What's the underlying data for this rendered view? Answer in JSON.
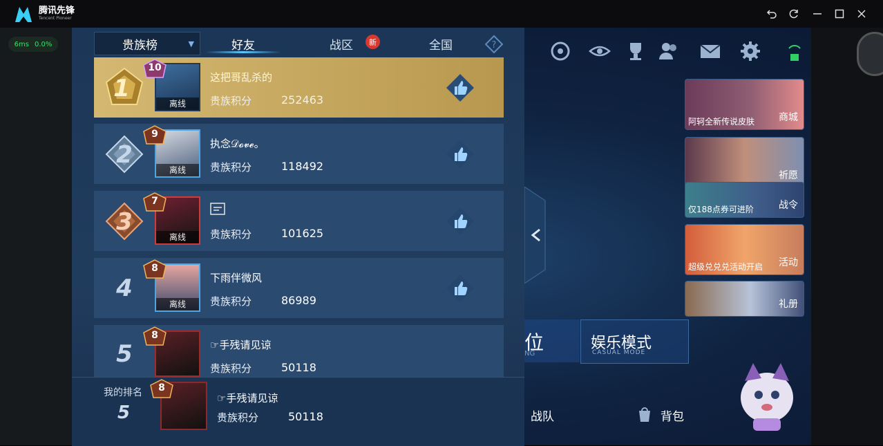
{
  "app": {
    "name": "腾讯先锋",
    "subtitle": "Tencent Pioneer"
  },
  "window_controls": [
    "back-icon",
    "refresh-icon",
    "minimize-icon",
    "maximize-icon",
    "close-icon"
  ],
  "ping": {
    "latency": "6ms",
    "loss": "0.0%"
  },
  "tabs": {
    "dropdown": "贵族榜",
    "items": [
      {
        "label": "好友",
        "active": true
      },
      {
        "label": "战区",
        "badge": "新"
      },
      {
        "label": "全国"
      }
    ]
  },
  "rows": [
    {
      "rank": "1",
      "level": "10",
      "name": "这把哥乱杀的",
      "score_label": "贵族积分",
      "score": "252463",
      "status": "离线"
    },
    {
      "rank": "2",
      "level": "9",
      "name": "执念𝒟𝓸𝓿𝓮。",
      "score_label": "贵族积分",
      "score": "118492",
      "status": "离线"
    },
    {
      "rank": "3",
      "level": "7",
      "name": "",
      "score_label": "贵族积分",
      "score": "101625",
      "status": "离线"
    },
    {
      "rank": "4",
      "level": "8",
      "name": "下雨伴微风",
      "score_label": "贵族积分",
      "score": "86989",
      "status": "离线"
    },
    {
      "rank": "5",
      "level": "8",
      "name": "☞手残请见谅",
      "score_label": "贵族积分",
      "score": "50118",
      "status": ""
    }
  ],
  "my_rank": {
    "label": "我的排名",
    "rank": "5",
    "level": "8",
    "name": "☞手残请见谅",
    "score_label": "贵族积分",
    "score": "50118"
  },
  "side_cards": [
    {
      "caption": "阿轲全新传说皮肤",
      "label": "商城"
    },
    {
      "caption": "",
      "label": "祈愿"
    },
    {
      "caption": "仅188点券可进阶",
      "label": "战令"
    },
    {
      "caption": "超级兑兑兑活动开启",
      "label": "活动"
    },
    {
      "caption": "",
      "label": "礼册"
    }
  ],
  "modes": {
    "left_title": "位",
    "left_sub": "NG",
    "title": "娱乐模式",
    "sub": "CASUAL MODE"
  },
  "bottom_nav": {
    "team": "战队",
    "bag": "背包"
  },
  "colors": {
    "gold_row": "#c9ab63",
    "row": "#2b4a70",
    "accent": "#5cc6ff"
  }
}
